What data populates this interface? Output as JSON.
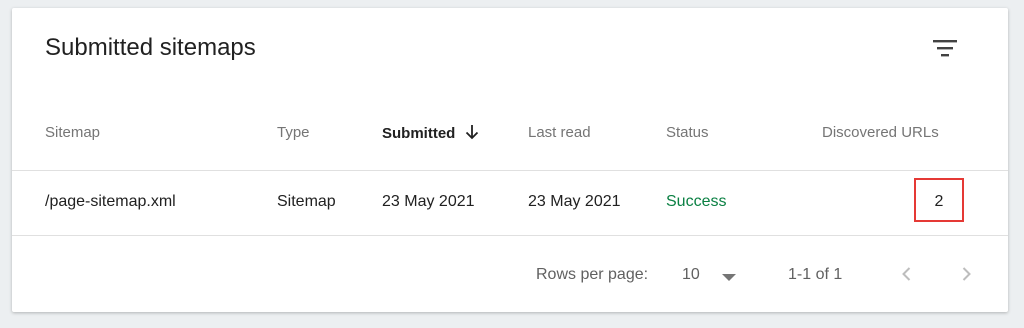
{
  "card": {
    "title": "Submitted sitemaps"
  },
  "table": {
    "columns": [
      "Sitemap",
      "Type",
      "Submitted",
      "Last read",
      "Status",
      "Discovered URLs"
    ],
    "sorted_column": "Submitted",
    "rows": [
      {
        "sitemap": "/page-sitemap.xml",
        "type": "Sitemap",
        "submitted": "23 May 2021",
        "last_read": "23 May 2021",
        "status": "Success",
        "discovered_urls": "2"
      }
    ]
  },
  "pagination": {
    "rows_per_page_label": "Rows per page:",
    "rows_per_page_value": "10",
    "range_label": "1-1 of 1"
  },
  "colors": {
    "success": "#0b8043",
    "highlight_box": "#e53935",
    "header_active": "#212121",
    "header_muted": "#757575"
  },
  "icons": {
    "filter": "filter-icon",
    "sort": "arrow-down-icon",
    "prev": "chevron-left-icon",
    "next": "chevron-right-icon",
    "dropdown": "caret-down-icon"
  }
}
